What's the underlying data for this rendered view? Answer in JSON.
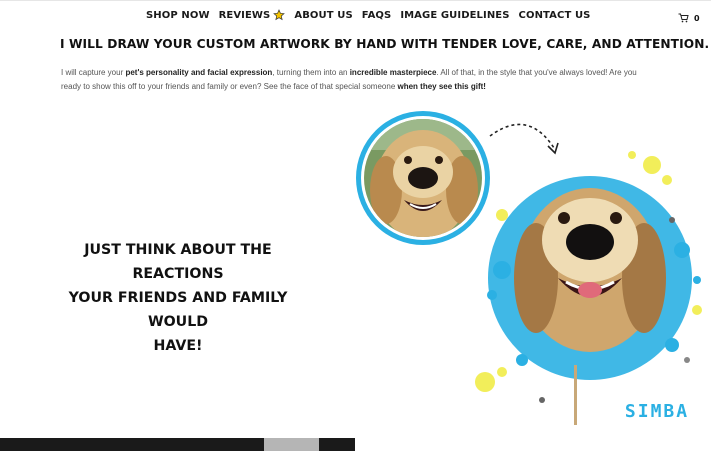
{
  "nav": {
    "items": [
      {
        "label": "SHOP NOW"
      },
      {
        "label": "REVIEWS"
      },
      {
        "label": "ABOUT US"
      },
      {
        "label": "FAQS"
      },
      {
        "label": "IMAGE GUIDELINES"
      },
      {
        "label": "CONTACT US"
      }
    ],
    "cart_count": "0"
  },
  "hero": {
    "headline": "I WILL DRAW YOUR CUSTOM ARTWORK BY HAND WITH TENDER LOVE, CARE, AND ATTENTION.",
    "paragraph": {
      "p1": "I will capture your ",
      "b1": "pet's personality and facial expression",
      "p2": ", turning them into an ",
      "b2": "incredible masterpiece",
      "p3": ". All of that, in the style that you've always loved! Are you ready to show this off to your friends and family or even?  See the face of that special someone ",
      "b3": "when they see this gift!"
    }
  },
  "tagline": {
    "line1": "JUST THINK ABOUT THE REACTIONS",
    "line2": "YOUR FRIENDS AND FAMILY WOULD",
    "line3": "HAVE!"
  },
  "artwork": {
    "pet_name": "SIMBA"
  },
  "colors": {
    "accent_blue": "#29b6e6",
    "heart_orange": "#f07a1a",
    "star_yellow": "#f5c400",
    "splash_yellow": "#f2ee5a"
  },
  "icons": {
    "cart": "cart-icon",
    "star": "star-icon",
    "heart": "heart-icon",
    "arrow": "dashed-arrow-icon"
  }
}
